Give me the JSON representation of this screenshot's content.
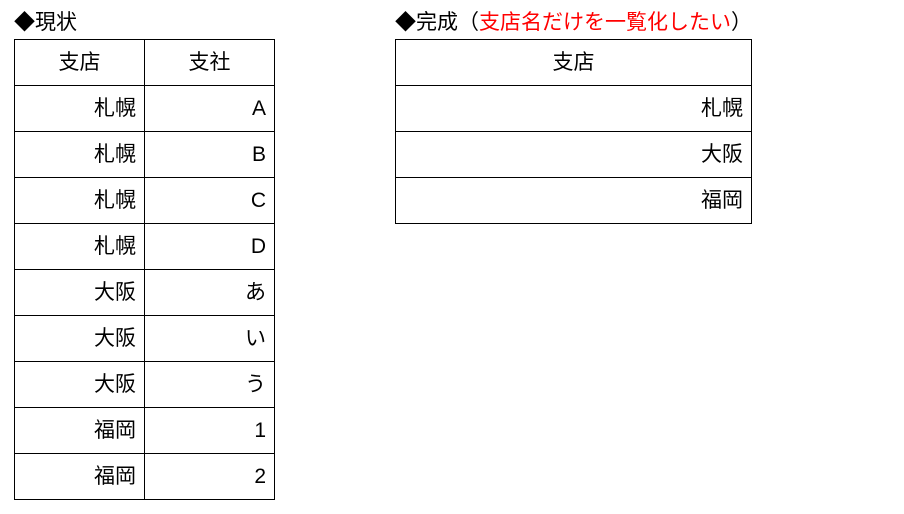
{
  "left": {
    "title_prefix": "◆",
    "title_text": "現状",
    "headers": [
      "支店",
      "支社"
    ],
    "rows": [
      [
        "札幌",
        "A"
      ],
      [
        "札幌",
        "B"
      ],
      [
        "札幌",
        "C"
      ],
      [
        "札幌",
        "D"
      ],
      [
        "大阪",
        "あ"
      ],
      [
        "大阪",
        "い"
      ],
      [
        "大阪",
        "う"
      ],
      [
        "福岡",
        "1"
      ],
      [
        "福岡",
        "2"
      ]
    ]
  },
  "right": {
    "title_prefix": "◆",
    "title_text": "完成",
    "paren_open": "（",
    "title_note": "支店名だけを一覧化したい",
    "paren_close": "）",
    "headers": [
      "支店"
    ],
    "rows": [
      [
        "札幌"
      ],
      [
        "大阪"
      ],
      [
        "福岡"
      ]
    ]
  }
}
